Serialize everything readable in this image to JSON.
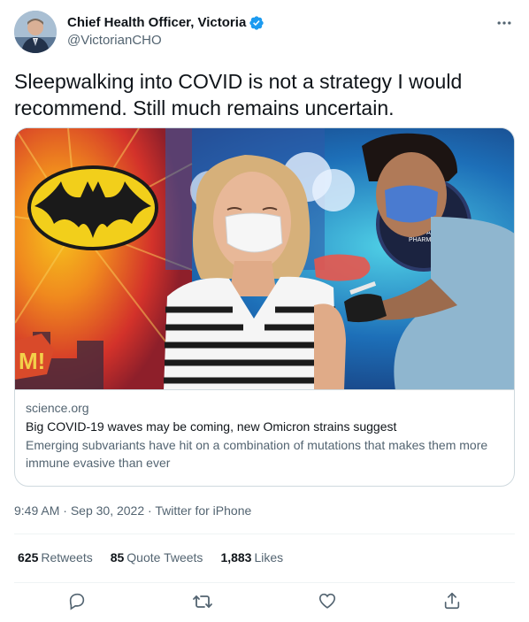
{
  "author": {
    "display_name": "Chief Health Officer, Victoria",
    "handle": "@VictorianCHO",
    "verified": true
  },
  "tweet": {
    "text": "Sleepwalking into COVID is not a strategy I would recommend. Still much remains uncertain."
  },
  "card": {
    "image_text": {
      "pharmacy_line1": "SKIPPACK",
      "pharmacy_line2": "PHARMACY",
      "comic_burst": "M!"
    },
    "domain": "science.org",
    "title": "Big COVID-19 waves may be coming, new Omicron strains suggest",
    "description": "Emerging subvariants have hit on a combination of mutations that makes them more immune evasive than ever"
  },
  "meta": {
    "time": "9:49 AM",
    "separator": "·",
    "date": "Sep 30, 2022",
    "source": "Twitter for iPhone"
  },
  "stats": {
    "retweets_count": "625",
    "retweets_label": "Retweets",
    "quotes_count": "85",
    "quotes_label": "Quote Tweets",
    "likes_count": "1,883",
    "likes_label": "Likes"
  },
  "icons": {
    "verified": "verified-badge-icon",
    "more": "more-icon",
    "reply": "reply-icon",
    "retweet": "retweet-icon",
    "like": "like-icon",
    "share": "share-icon"
  },
  "colors": {
    "verified_blue": "#1d9bf0",
    "text_primary": "#0f1419",
    "text_secondary": "#536471",
    "border": "#cfd9de"
  }
}
